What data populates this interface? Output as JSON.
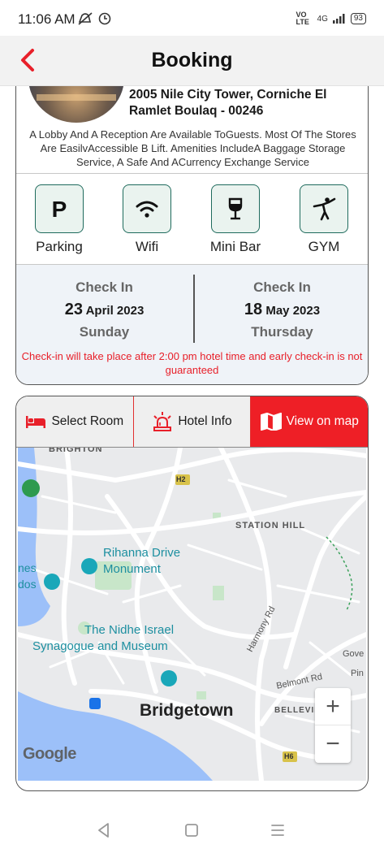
{
  "status_bar": {
    "time": "11:06 AM",
    "network": "4G",
    "volte": "VO LTE",
    "battery": "93"
  },
  "header": {
    "title": "Booking"
  },
  "hotel": {
    "address": "2005 Nile City Tower, Corniche El Ramlet Boulaq - 00246",
    "description": "A Lobby And A Reception Are Available ToGuests. Most Of The Stores Are EasilvAccessible B Lift. Amenities IncludeA Baggage Storage Service, A Safe And ACurrency Exchange Service",
    "amenities": [
      {
        "label": "Parking",
        "icon": "parking-icon"
      },
      {
        "label": "Wifi",
        "icon": "wifi-icon"
      },
      {
        "label": "Mini Bar",
        "icon": "wine-glass-icon"
      },
      {
        "label": "GYM",
        "icon": "gym-icon"
      }
    ]
  },
  "checkin": {
    "title": "Check In",
    "day": "23",
    "month_year": "April 2023",
    "weekday": "Sunday"
  },
  "checkout": {
    "title": "Check In",
    "day": "18",
    "month_year": "May 2023",
    "weekday": "Thursday"
  },
  "checkin_note": "Check-in will take place after 2:00 pm hotel time and early check-in is not  guaranteed",
  "tabs": [
    {
      "label": "Select Room",
      "icon": "bed-icon",
      "active": false
    },
    {
      "label": "Hotel Info",
      "icon": "alarm-light-icon",
      "active": false
    },
    {
      "label": "View on map",
      "icon": "map-icon",
      "active": true
    }
  ],
  "map": {
    "labels": {
      "brighton": "BRIGHTON",
      "station_hill": "STATION HILL",
      "rihanna": "Rihanna Drive Monument",
      "rihanna_line1": "Rihanna Drive",
      "rihanna_line2": "Monument",
      "nidhe_line1": "The Nidhe Israel",
      "nidhe_line2": "Synagogue and Museum",
      "harmony": "Harmony Rd",
      "belmont": "Belmont Rd",
      "bridgetown": "Bridgetown",
      "belleville": "BELLEVILLE",
      "nes": "nes",
      "dos": "dos",
      "gove": "Gove",
      "pin": "Pin",
      "h2": "H2",
      "h6": "H6",
      "google": "Google"
    },
    "zoom_in": "+",
    "zoom_out": "−"
  },
  "colors": {
    "accent": "#ee1f26",
    "amenity_border": "#1f6b5d",
    "checkin_bg": "#eff3f8"
  }
}
